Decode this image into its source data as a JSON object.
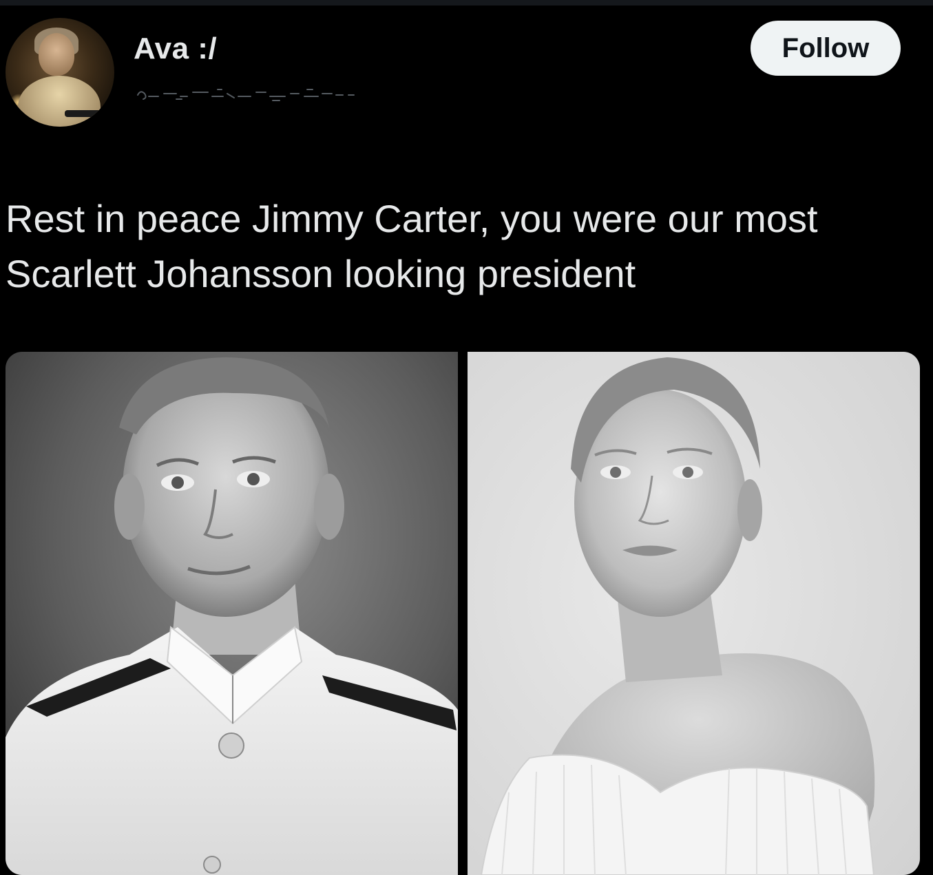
{
  "post": {
    "author_name": "Ava :/",
    "follow_label": "Follow",
    "text_line1": "Rest in peace Jimmy Carter, you were our most",
    "text_line2": "Scarlett Johansson looking president"
  },
  "media": {
    "count": 2,
    "left_photo_icon": "portrait-photo-icon",
    "right_photo_icon": "portrait-photo-icon"
  },
  "colors": {
    "background": "#000000",
    "text": "#e7e9ea",
    "follow_button_bg": "#eff3f4",
    "follow_button_text": "#0f1419"
  }
}
